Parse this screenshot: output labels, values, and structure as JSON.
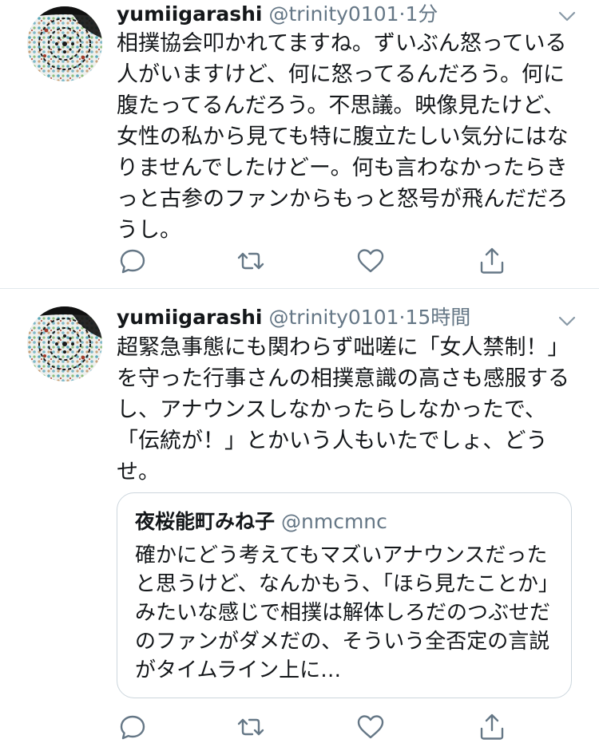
{
  "tweets": [
    {
      "name": "yumiigarashi",
      "handle": "@trinity0101",
      "separator": "·",
      "time": "1分",
      "text": "相撲協会叩かれてますね。ずいぶん怒っている人がいますけど、何に怒ってるんだろう。何に腹たってるんだろう。不思議。映像見たけど、女性の私から見ても特に腹立たしい気分にはなりませんでしたけどー。何も言わなかったらきっと古参のファンからもっと怒号が飛んだだろうし。",
      "actions": [
        "reply-icon",
        "retweet-icon",
        "like-icon",
        "share-icon"
      ]
    },
    {
      "name": "yumiigarashi",
      "handle": "@trinity0101",
      "separator": "·",
      "time": "15時間",
      "text": "超緊急事態にも関わらず咄嗟に「女人禁制！」を守った行事さんの相撲意識の高さも感服するし、アナウンスしなかったらしなかったで、「伝統が！」とかいう人もいたでしょ、どうせ。",
      "quote": {
        "name": "夜桜能町みね子",
        "handle": "@nmcmnc",
        "text": "確かにどう考えてもマズいアナウンスだったと思うけど、なんかもう、「ほら見たことか」みたいな感じで相撲は解体しろだのつぶせだのファンがダメだの、そういう全否定の言説がタイムライン上に…"
      },
      "actions": [
        "reply-icon",
        "retweet-icon",
        "like-icon",
        "share-icon"
      ]
    }
  ],
  "colors": {
    "text_primary": "#14171a",
    "text_secondary": "#657786",
    "icon": "#657786",
    "divider": "#e1e8ed",
    "quote_border": "#ccd6dd"
  }
}
